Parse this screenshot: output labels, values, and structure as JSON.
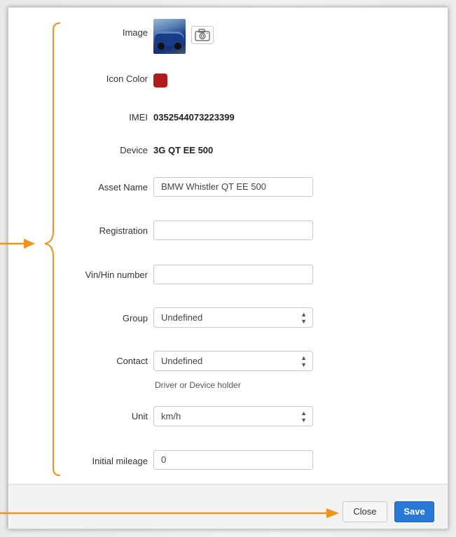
{
  "form": {
    "image": {
      "label": "Image",
      "thumbnail_icon": "car-photo",
      "upload_icon": "camera-icon"
    },
    "icon_color": {
      "label": "Icon Color",
      "color": "#b01b1b"
    },
    "imei": {
      "label": "IMEI",
      "value": "0352544073223399"
    },
    "device": {
      "label": "Device",
      "value": "3G QT EE 500"
    },
    "asset_name": {
      "label": "Asset Name",
      "value": "BMW Whistler QT EE 500"
    },
    "registration": {
      "label": "Registration",
      "value": ""
    },
    "vin": {
      "label": "Vin/Hin number",
      "value": ""
    },
    "group": {
      "label": "Group",
      "value": "Undefined"
    },
    "contact": {
      "label": "Contact",
      "value": "Undefined",
      "hint": "Driver or Device holder"
    },
    "unit": {
      "label": "Unit",
      "value": "km/h"
    },
    "initial_mileage": {
      "label": "Initial mileage",
      "value": "0"
    }
  },
  "footer": {
    "close_label": "Close",
    "save_label": "Save"
  },
  "annotation": {
    "color": "#f0921e"
  }
}
